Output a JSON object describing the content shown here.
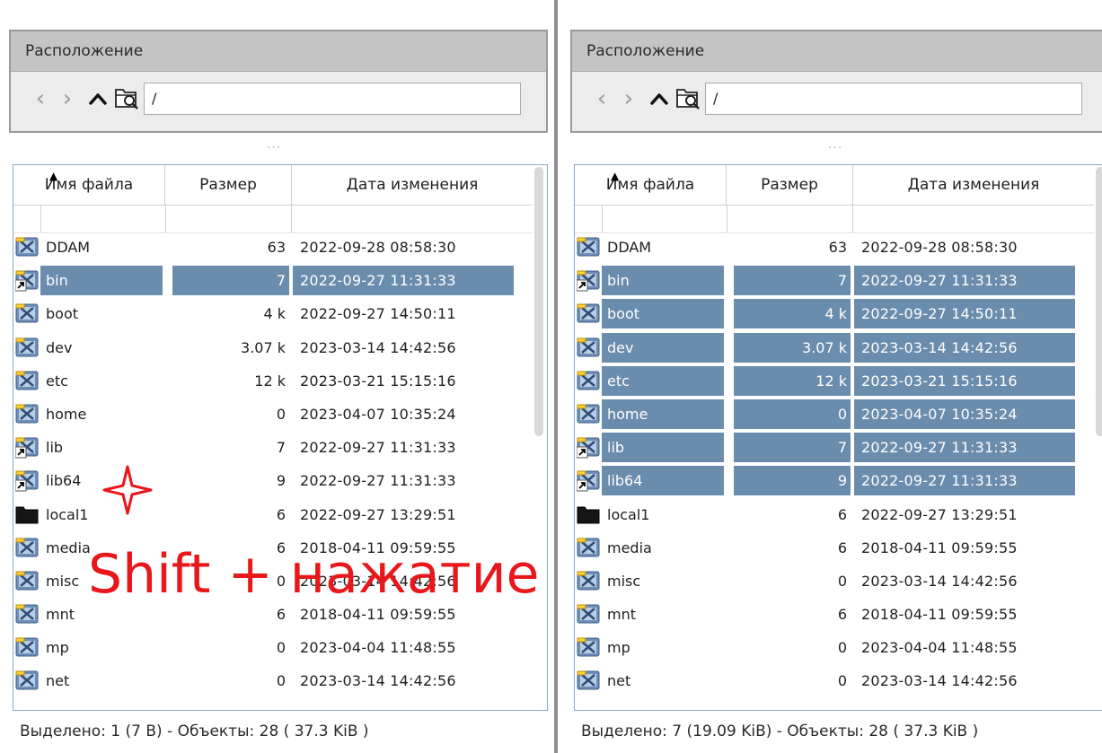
{
  "panels": [
    {
      "location_title": "Расположение",
      "path": "/",
      "grip": "···",
      "columns": {
        "name": "Имя файла",
        "size": "Размер",
        "date": "Дата изменения"
      },
      "files": [
        {
          "name": "DDAM",
          "size": "63",
          "date": "2022-09-28 08:58:30",
          "icon": "folder-icon",
          "selected": false
        },
        {
          "name": "bin",
          "size": "7",
          "date": "2022-09-27 11:31:33",
          "icon": "folder-link-icon",
          "selected": true
        },
        {
          "name": "boot",
          "size": "4 k",
          "date": "2022-09-27 14:50:11",
          "icon": "folder-icon",
          "selected": false
        },
        {
          "name": "dev",
          "size": "3.07 k",
          "date": "2023-03-14 14:42:56",
          "icon": "folder-icon",
          "selected": false
        },
        {
          "name": "etc",
          "size": "12 k",
          "date": "2023-03-21 15:15:16",
          "icon": "folder-icon",
          "selected": false
        },
        {
          "name": "home",
          "size": "0",
          "date": "2023-04-07 10:35:24",
          "icon": "folder-icon",
          "selected": false
        },
        {
          "name": "lib",
          "size": "7",
          "date": "2022-09-27 11:31:33",
          "icon": "folder-link-icon",
          "selected": false
        },
        {
          "name": "lib64",
          "size": "9",
          "date": "2022-09-27 11:31:33",
          "icon": "folder-link-icon",
          "selected": false
        },
        {
          "name": "local1",
          "size": "6",
          "date": "2022-09-27 13:29:51",
          "icon": "black-folder-icon",
          "selected": false
        },
        {
          "name": "media",
          "size": "6",
          "date": "2018-04-11 09:59:55",
          "icon": "folder-icon",
          "selected": false
        },
        {
          "name": "misc",
          "size": "0",
          "date": "2023-03-14 14:42:56",
          "icon": "folder-icon",
          "selected": false
        },
        {
          "name": "mnt",
          "size": "6",
          "date": "2018-04-11 09:59:55",
          "icon": "folder-icon",
          "selected": false
        },
        {
          "name": "mp",
          "size": "0",
          "date": "2023-04-04 11:48:55",
          "icon": "folder-icon",
          "selected": false
        },
        {
          "name": "net",
          "size": "0",
          "date": "2023-03-14 14:42:56",
          "icon": "folder-icon",
          "selected": false
        }
      ],
      "status": "Выделено: 1 (7 B)  -  Объекты: 28 ( 37.3 KiB )"
    },
    {
      "location_title": "Расположение",
      "path": "/",
      "grip": "···",
      "columns": {
        "name": "Имя файла",
        "size": "Размер",
        "date": "Дата изменения"
      },
      "files": [
        {
          "name": "DDAM",
          "size": "63",
          "date": "2022-09-28 08:58:30",
          "icon": "folder-icon",
          "selected": false
        },
        {
          "name": "bin",
          "size": "7",
          "date": "2022-09-27 11:31:33",
          "icon": "folder-link-icon",
          "selected": true
        },
        {
          "name": "boot",
          "size": "4 k",
          "date": "2022-09-27 14:50:11",
          "icon": "folder-icon",
          "selected": true
        },
        {
          "name": "dev",
          "size": "3.07 k",
          "date": "2023-03-14 14:42:56",
          "icon": "folder-icon",
          "selected": true
        },
        {
          "name": "etc",
          "size": "12 k",
          "date": "2023-03-21 15:15:16",
          "icon": "folder-icon",
          "selected": true
        },
        {
          "name": "home",
          "size": "0",
          "date": "2023-04-07 10:35:24",
          "icon": "folder-icon",
          "selected": true
        },
        {
          "name": "lib",
          "size": "7",
          "date": "2022-09-27 11:31:33",
          "icon": "folder-link-icon",
          "selected": true
        },
        {
          "name": "lib64",
          "size": "9",
          "date": "2022-09-27 11:31:33",
          "icon": "folder-link-icon",
          "selected": true
        },
        {
          "name": "local1",
          "size": "6",
          "date": "2022-09-27 13:29:51",
          "icon": "black-folder-icon",
          "selected": false
        },
        {
          "name": "media",
          "size": "6",
          "date": "2018-04-11 09:59:55",
          "icon": "folder-icon",
          "selected": false
        },
        {
          "name": "misc",
          "size": "0",
          "date": "2023-03-14 14:42:56",
          "icon": "folder-icon",
          "selected": false
        },
        {
          "name": "mnt",
          "size": "6",
          "date": "2018-04-11 09:59:55",
          "icon": "folder-icon",
          "selected": false
        },
        {
          "name": "mp",
          "size": "0",
          "date": "2023-04-04 11:48:55",
          "icon": "folder-icon",
          "selected": false
        },
        {
          "name": "net",
          "size": "0",
          "date": "2023-03-14 14:42:56",
          "icon": "folder-icon",
          "selected": false
        }
      ],
      "status": "Выделено: 7 (19.09 KiB)  -  Объекты: 28 ( 37.3 KiB )"
    }
  ],
  "annotation": {
    "text": "Shift + нажатие",
    "color": "#e8171b"
  },
  "colors": {
    "selection": "#6a8cad",
    "header": "#c4c4c4",
    "frame": "#8aa8c8"
  }
}
